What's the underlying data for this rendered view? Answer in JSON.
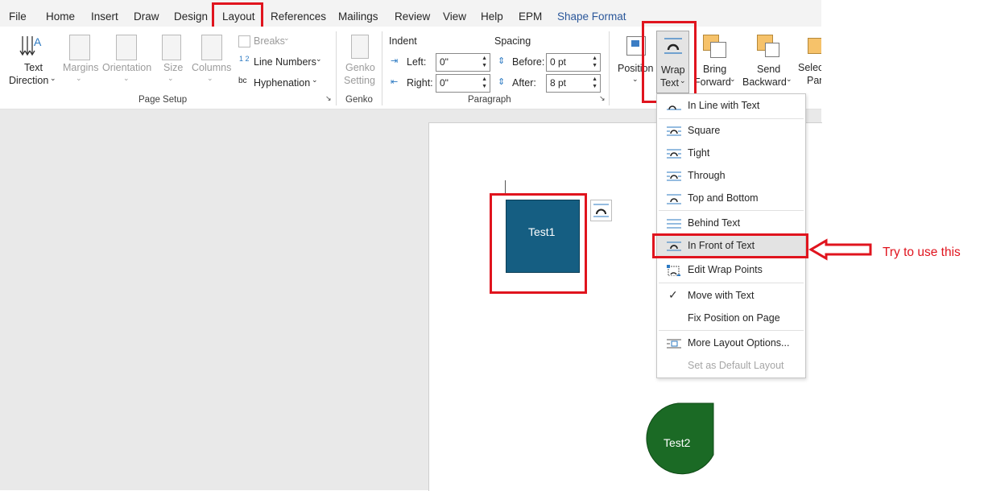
{
  "tabs": [
    "File",
    "Home",
    "Insert",
    "Draw",
    "Design",
    "Layout",
    "References",
    "Mailings",
    "Review",
    "View",
    "Help",
    "EPM",
    "Shape Format"
  ],
  "active_tab": "Layout",
  "ribbon": {
    "text_direction": [
      "Text",
      "Direction"
    ],
    "margins": "Margins",
    "orientation": "Orientation",
    "size": "Size",
    "columns": "Columns",
    "breaks": "Breaks",
    "line_numbers": "Line Numbers",
    "hyphenation": "Hyphenation",
    "page_setup_group": "Page Setup",
    "genko_setting": [
      "Genko",
      "Setting"
    ],
    "genko_group": "Genko",
    "indent_label": "Indent",
    "spacing_label": "Spacing",
    "left_label": "Left:",
    "right_label": "Right:",
    "left_value": "0\"",
    "right_value": "0\"",
    "before_label": "Before:",
    "after_label": "After:",
    "before_value": "0 pt",
    "after_value": "8 pt",
    "paragraph_group": "Paragraph",
    "position": "Position",
    "wrap_text": [
      "Wrap",
      "Text"
    ],
    "bring_forward": [
      "Bring",
      "Forward"
    ],
    "send_backward": [
      "Send",
      "Backward"
    ],
    "selection_pane": [
      "Select",
      "Pan"
    ]
  },
  "wrap_menu": {
    "items": [
      "In Line with Text",
      "Square",
      "Tight",
      "Through",
      "Top and Bottom",
      "Behind Text",
      "In Front of Text",
      "Edit Wrap Points",
      "Move with Text",
      "Fix Position on Page",
      "More Layout Options...",
      "Set as Default Layout"
    ]
  },
  "shapes": {
    "test1": "Test1",
    "test2": "Test2"
  },
  "annotation": "Try to use this",
  "colors": {
    "accent": "#2b579a",
    "highlight": "#e0141e",
    "test1": "#155e82",
    "test2": "#1b6a25"
  }
}
